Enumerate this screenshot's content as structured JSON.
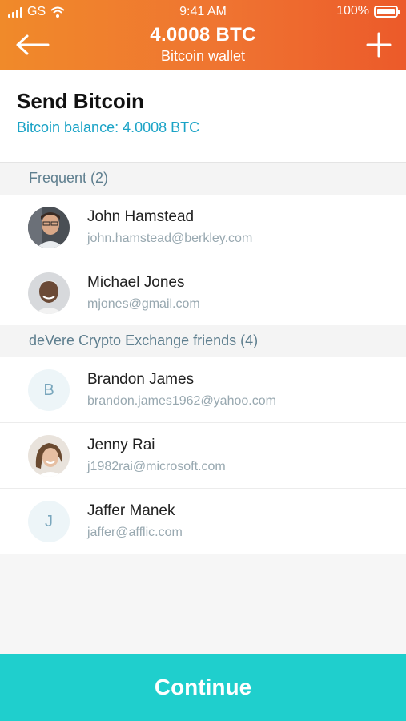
{
  "status_bar": {
    "carrier": "GS",
    "time": "9:41 AM",
    "battery": "100%"
  },
  "header": {
    "title": "4.0008 BTC",
    "subtitle": "Bitcoin wallet",
    "back_icon": "arrow-left-icon",
    "add_icon": "plus-icon"
  },
  "send": {
    "title": "Send Bitcoin",
    "balance": "Bitcoin balance: 4.0008 BTC"
  },
  "sections": [
    {
      "label": "Frequent (2)"
    },
    {
      "label": "deVere Crypto Exchange friends (4)"
    }
  ],
  "contacts": [
    {
      "name": "John Hamstead",
      "email": "john.hamstead@berkley.com"
    },
    {
      "name": "Michael Jones",
      "email": "mjones@gmail.com"
    },
    {
      "name": "Brandon James",
      "email": "brandon.james1962@yahoo.com",
      "initial": "B"
    },
    {
      "name": "Jenny Rai",
      "email": "j1982rai@microsoft.com"
    },
    {
      "name": "Jaffer Manek",
      "email": "jaffer@afflic.com",
      "initial": "J"
    }
  ],
  "continue_label": "Continue",
  "colors": {
    "header_start": "#f08a2a",
    "header_end": "#ec5a2a",
    "accent": "#1aa3c6",
    "button": "#1fcfcd"
  }
}
